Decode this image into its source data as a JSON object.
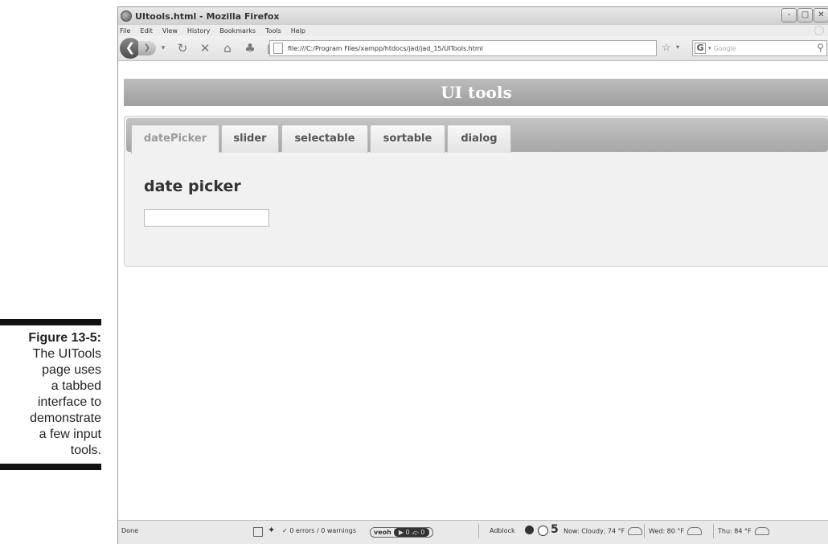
{
  "caption": {
    "label": "Figure 13-5:",
    "text_lines": [
      "The UITools",
      "page uses",
      "a tabbed",
      "interface to",
      "demonstrate",
      "a few input",
      "tools."
    ]
  },
  "browser": {
    "title": "UItools.html - Mozilla Firefox",
    "controls": [
      "-",
      "□",
      "✕"
    ],
    "menu": [
      "File",
      "Edit",
      "View",
      "History",
      "Bookmarks",
      "Tools",
      "Help"
    ],
    "url": "file:///C:/Program Files/xampp/htdocs/jad/jad_15/UITools.html",
    "search_placeholder": "Google",
    "search_engine_glyph": "G"
  },
  "page": {
    "header": "UI tools",
    "tabs": [
      "datePicker",
      "slider",
      "selectable",
      "sortable",
      "dialog"
    ],
    "active_tab": "datePicker",
    "panel_heading": "date picker",
    "date_value": ""
  },
  "status": {
    "left": "Done",
    "errors": "0 errors / 0 warnings",
    "veoh_label": "veoh",
    "veoh_bar": "▶ 0  ⤽ 0",
    "adblock": "Adblock",
    "five": "5",
    "now": "Now: Cloudy, 74 °F",
    "wed": "Wed: 80 °F",
    "thu": "Thu: 84 °F"
  },
  "colors": {
    "header_bg": "#a8a8a8",
    "tab_strip_bg": "#b3b3b3",
    "panel_bg": "#f1f1f1"
  }
}
